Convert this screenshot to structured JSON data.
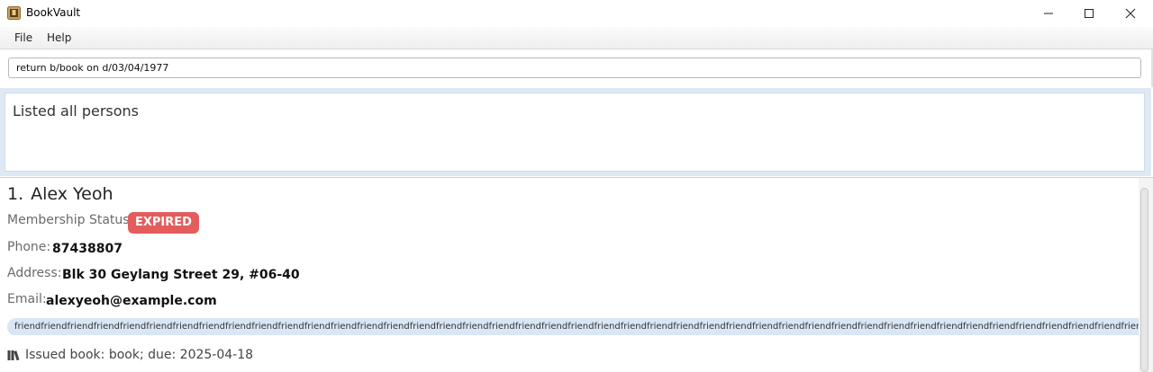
{
  "window": {
    "title": "BookVault",
    "icon": "bookvault-app-icon",
    "controls": [
      "minimize-icon",
      "maximize-icon",
      "close-icon"
    ]
  },
  "menu": {
    "items": [
      {
        "label": "File"
      },
      {
        "label": "Help"
      }
    ]
  },
  "command": {
    "value": "return b/book on d/03/04/1977"
  },
  "result": {
    "text": "Listed all persons"
  },
  "persons": [
    {
      "index": "1.",
      "name": "Alex Yeoh",
      "membership_label": "Membership Status:",
      "membership_status": "EXPIRED",
      "phone_label": "Phone:",
      "phone": "87438807",
      "address_label": "Address:",
      "address": "Blk 30 Geylang Street 29, #06-40",
      "email_label": "Email:",
      "email": "alexyeoh@example.com",
      "tag": "friendfriendfriendfriendfriendfriendfriendfriendfriendfriendfriendfriendfriendfriendfriendfriendfriendfriendfriendfriendfriendfriendfriendfriendfriendfriendfriendfriendfriendfriendfriendfriendfriendfriendfriendfriendfriendfriendfriendfriendfriendfriendfriendfriendfriendfriendfriendfriendfriendfriendfriendfriendfriendfriendfriendfriendfriendfriendfriendfriendfriendfriendfriendfriendfriendfriendfriendfriendfriendfriendfriendfriendfriendfriendfriendfriendfriendfriendfriendfriend",
      "issued": "Issued book: book; due: 2025-04-18"
    }
  ],
  "colors": {
    "expired_badge": "#e35d5d",
    "tag_bg": "#d9e6f5",
    "result_frame": "#dfe9f3"
  }
}
